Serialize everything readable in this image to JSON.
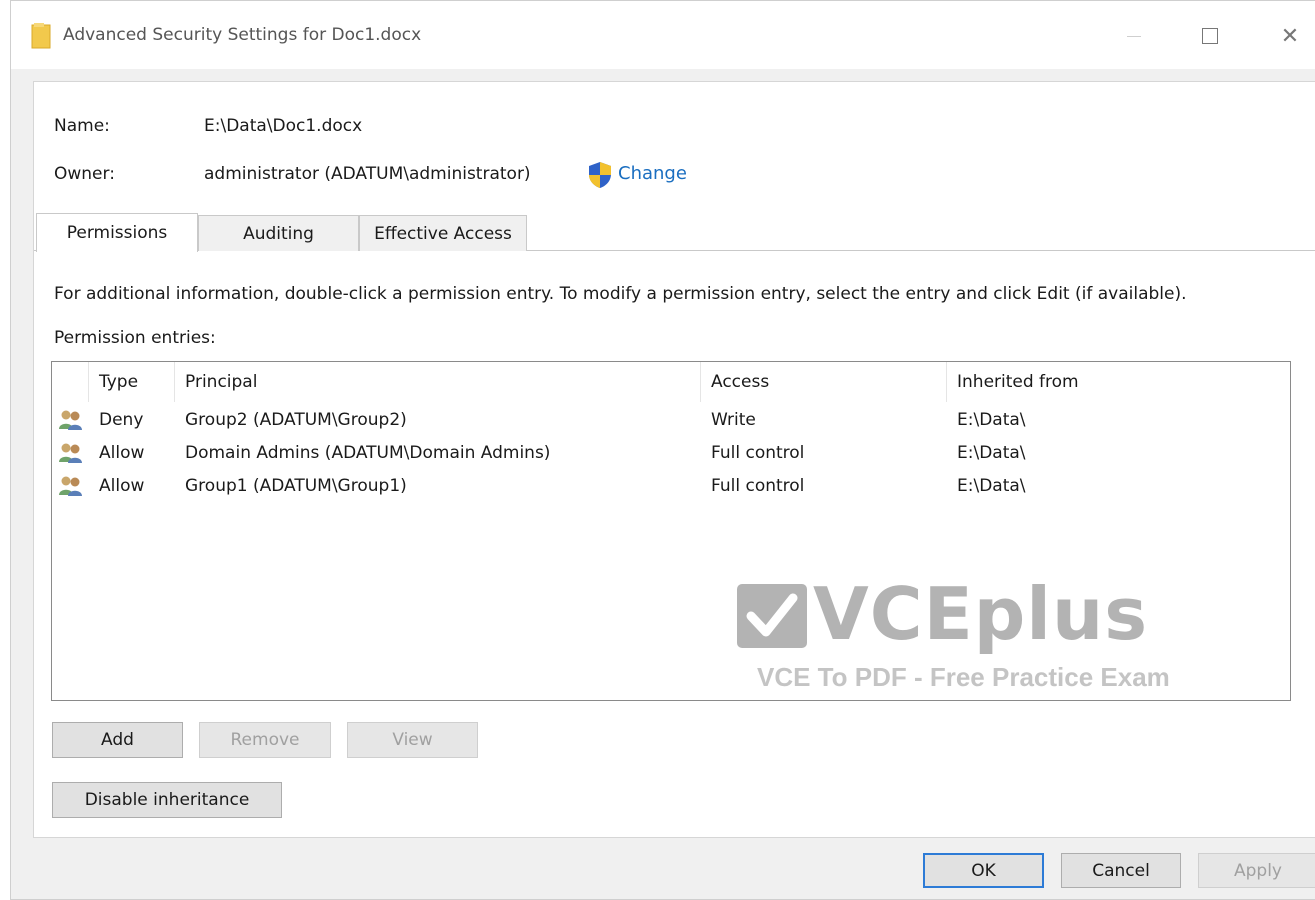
{
  "window": {
    "title": "Advanced Security Settings for Doc1.docx"
  },
  "details": {
    "name_label": "Name:",
    "name_value": "E:\\Data\\Doc1.docx",
    "owner_label": "Owner:",
    "owner_value": "administrator  (ADATUM\\administrator)",
    "change_link": "Change"
  },
  "tabs": [
    {
      "label": "Permissions",
      "active": true
    },
    {
      "label": "Auditing",
      "active": false
    },
    {
      "label": "Effective Access",
      "active": false
    }
  ],
  "permissions": {
    "info_text": "For additional information, double-click a permission entry. To modify a permission entry, select the entry and click Edit (if available).",
    "entries_label": "Permission entries:",
    "columns": [
      "Type",
      "Principal",
      "Access",
      "Inherited from"
    ],
    "entries": [
      {
        "type": "Deny",
        "principal": "Group2 (ADATUM\\Group2)",
        "access": "Write",
        "inherited_from": "E:\\Data\\"
      },
      {
        "type": "Allow",
        "principal": "Domain Admins (ADATUM\\Domain  Admins)",
        "access": "Full control",
        "inherited_from": "E:\\Data\\"
      },
      {
        "type": "Allow",
        "principal": "Group1 (ADATUM\\Group1)",
        "access": "Full control",
        "inherited_from": "E:\\Data\\"
      }
    ],
    "buttons": {
      "add": "Add",
      "remove": "Remove",
      "view": "View",
      "disable_inheritance": "Disable inheritance"
    }
  },
  "watermark": {
    "brand": "VCEplus",
    "subtitle": "VCE To PDF - Free Practice Exam"
  },
  "footer": {
    "ok": "OK",
    "cancel": "Cancel",
    "apply": "Apply"
  },
  "colors": {
    "link": "#1a6ec0",
    "ok_border": "#2d7bd6",
    "watermark": "#b3b3b3"
  },
  "icons": {
    "title": "folder-icon",
    "change": "uac-shield-icon",
    "entry": "user-group-icon"
  }
}
